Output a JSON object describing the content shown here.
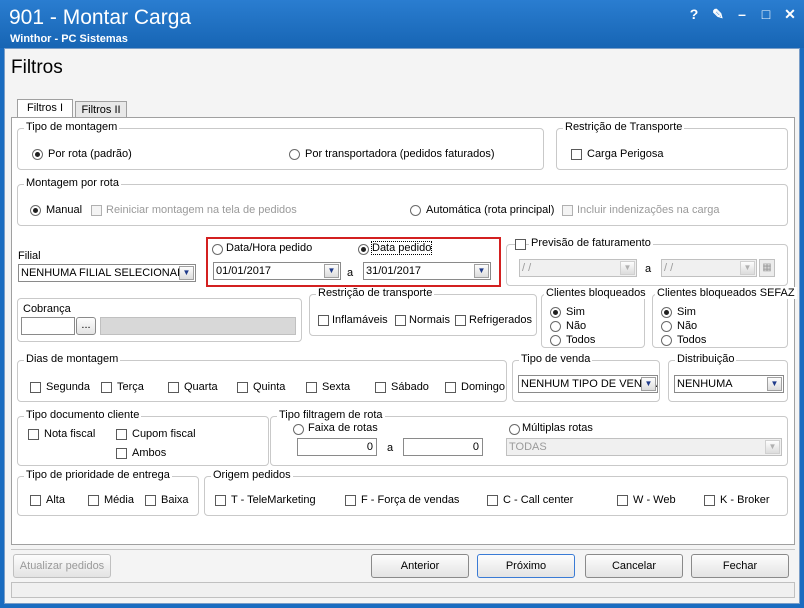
{
  "window": {
    "title": "901 - Montar Carga",
    "subtitle": "Winthor - PC Sistemas",
    "help_glyph": "?",
    "edit_glyph": "✎",
    "minimize_glyph": "–",
    "maximize_glyph": "□",
    "close_glyph": "✕"
  },
  "page_title": "Filtros",
  "tabs": [
    {
      "label": "Filtros I"
    },
    {
      "label": "Filtros II"
    }
  ],
  "tipo_montagem": {
    "label": "Tipo de montagem",
    "por_rota": "Por rota (padrão)",
    "por_transportadora": "Por transportadora (pedidos faturados)"
  },
  "restricao_transporte_top": {
    "label": "Restrição de Transporte",
    "carga_perigosa": "Carga Perigosa"
  },
  "montagem_por_rota": {
    "label": "Montagem por rota",
    "manual": "Manual",
    "reiniciar": "Reiniciar montagem na tela de pedidos",
    "automatica": "Automática (rota principal)",
    "incluir": "Incluir indenizações na carga"
  },
  "filial": {
    "label": "Filial",
    "value": "NENHUMA FILIAL SELECIONADA"
  },
  "datas": {
    "data_hora_pedido": "Data/Hora pedido",
    "data_pedido": "Data pedido",
    "start": "01/01/2017",
    "sep": "a",
    "end": "31/01/2017"
  },
  "previsao": {
    "label": "Previsão de faturamento",
    "start": "/ /",
    "sep": "a",
    "end": "/ /"
  },
  "cobranca": {
    "label": "Cobrança",
    "button": "..."
  },
  "restricao_transporte": {
    "label": "Restrição de transporte",
    "inflamaveis": "Inflamáveis",
    "normais": "Normais",
    "refrigerados": "Refrigerados"
  },
  "clientes_bloqueados": {
    "label": "Clientes bloqueados",
    "sim": "Sim",
    "nao": "Não",
    "todos": "Todos"
  },
  "clientes_bloqueados_sefaz": {
    "label": "Clientes bloqueados SEFAZ",
    "sim": "Sim",
    "nao": "Não",
    "todos": "Todos"
  },
  "dias_montagem": {
    "label": "Dias de montagem",
    "days": [
      "Segunda",
      "Terça",
      "Quarta",
      "Quinta",
      "Sexta",
      "Sábado",
      "Domingo"
    ]
  },
  "tipo_venda": {
    "label": "Tipo de venda",
    "value": "NENHUM TIPO DE VENDA"
  },
  "distribuicao": {
    "label": "Distribuição",
    "value": "NENHUMA"
  },
  "tipo_documento": {
    "label": "Tipo documento cliente",
    "nota_fiscal": "Nota fiscal",
    "cupom_fiscal": "Cupom fiscal",
    "ambos": "Ambos"
  },
  "tipo_filtragem_rota": {
    "label": "Tipo filtragem de rota",
    "faixa": "Faixa de rotas",
    "start": "0",
    "sep": "a",
    "end": "0",
    "multiplas": "Múltiplas rotas",
    "multiplas_value": "TODAS"
  },
  "prioridade": {
    "label": "Tipo de prioridade de  entrega",
    "alta": "Alta",
    "media": "Média",
    "baixa": "Baixa"
  },
  "origem": {
    "label": "Origem pedidos",
    "telemarketing": "T - TeleMarketing",
    "forca_vendas": "F - Força de vendas",
    "call_center": "C - Call center",
    "web": "W - Web",
    "broker": "K - Broker"
  },
  "footer": {
    "atualizar": "Atualizar pedidos",
    "anterior": "Anterior",
    "proximo": "Próximo",
    "cancelar": "Cancelar",
    "fechar": "Fechar"
  },
  "colors": {
    "title_bar": "#1765b4",
    "highlight": "#d32020"
  }
}
